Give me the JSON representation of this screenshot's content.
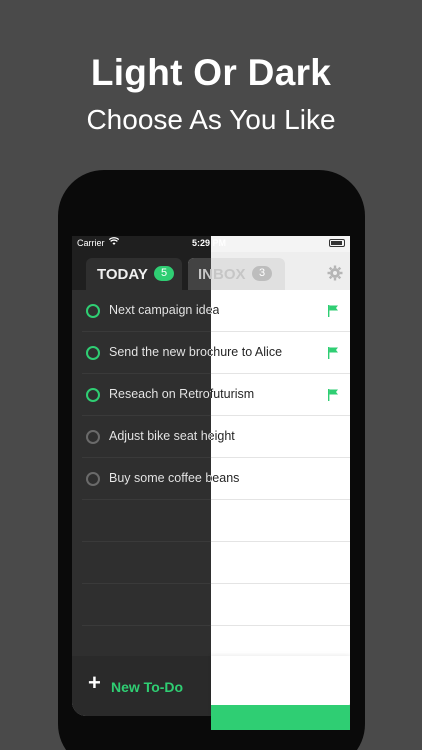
{
  "promo": {
    "headline": "Light Or Dark",
    "subheadline": "Choose As You Like"
  },
  "status_bar": {
    "carrier": "Carrier",
    "time": "5:29 PM"
  },
  "tabs": {
    "today": {
      "label": "TODAY",
      "count": "5"
    },
    "inbox": {
      "label": "INBOX",
      "count": "3"
    }
  },
  "tasks": [
    {
      "text": "Next campaign idea",
      "completed_style": "active",
      "flagged": true
    },
    {
      "text": "Send the new brochure to Alice",
      "completed_style": "active",
      "flagged": true
    },
    {
      "text": "Reseach on Retrofuturism",
      "completed_style": "active",
      "flagged": true
    },
    {
      "text": "Adjust bike seat height",
      "completed_style": "muted",
      "flagged": false
    },
    {
      "text": "Buy some coffee beans",
      "completed_style": "muted",
      "flagged": false
    }
  ],
  "new_todo": {
    "label": "New To-Do"
  },
  "colors": {
    "accent": "#2fce73",
    "dark_bg": "#2f2f2f",
    "light_bg": "#ffffff",
    "page_bg": "#4a4a4a"
  },
  "icons": [
    "wifi-icon",
    "battery-icon",
    "gear-icon",
    "flag-icon",
    "plus-icon"
  ]
}
